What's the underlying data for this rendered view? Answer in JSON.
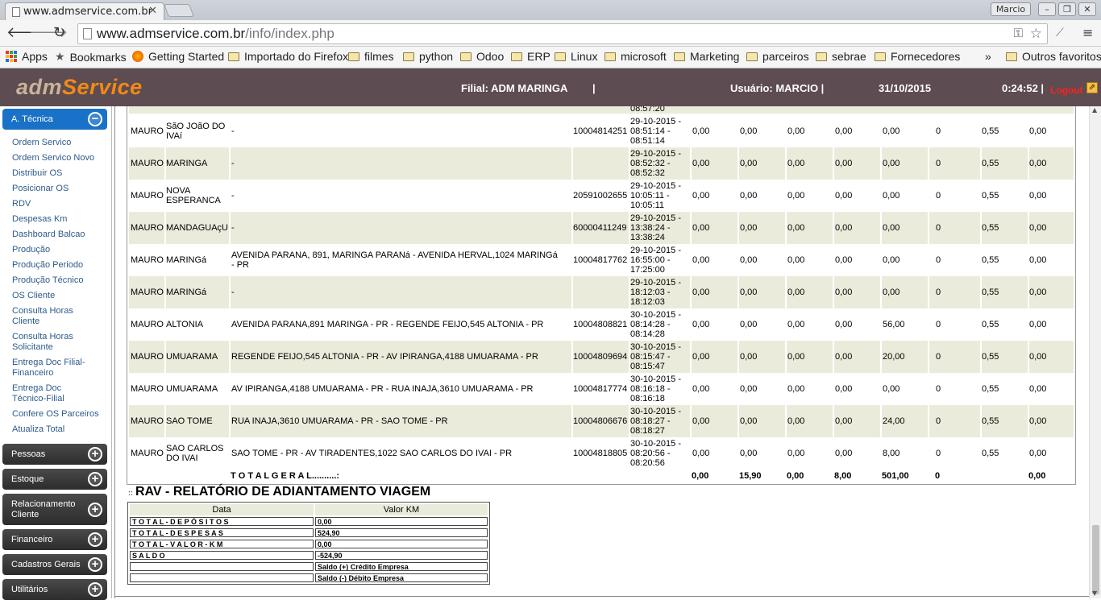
{
  "browser": {
    "tab_title": "www.admservice.com.br",
    "profile_name": "Marcio",
    "url_host": "www.admservice.com.br",
    "url_path": "/info/index.php",
    "bookmarks": [
      "Apps",
      "Bookmarks",
      "Getting Started",
      "Importado do Firefox",
      "filmes",
      "python",
      "Odoo",
      "ERP",
      "Linux",
      "microsoft",
      "Marketing",
      "parceiros",
      "sebrae",
      "Fornecedores"
    ],
    "overflow": "»",
    "other_bookmarks": "Outros favoritos"
  },
  "header": {
    "logo_adm": "adm",
    "logo_service": "Service",
    "filial": "Filial: ADM MARINGA",
    "sep": "|",
    "usuario": "Usuário: MARCIO |",
    "date": "31/10/2015",
    "time": "0:24:52 |",
    "logout": "Logout"
  },
  "sidebar": {
    "active_section": "A. Técnica",
    "items": [
      "Ordem Servico",
      "Ordem Servico Novo",
      "Distribuir OS",
      "Posicionar OS",
      "RDV",
      "Despesas Km",
      "Dashboard Balcao",
      "Produção",
      "Produção Periodo",
      "Produção Técnico",
      "OS Cliente",
      "Consulta Horas Cliente",
      "Consulta Horas Solicitante",
      "Entrega Doc Filial-Financeiro",
      "Entrega Doc Técnico-Filial",
      "Confere OS Parceiros",
      "Atualiza Total"
    ],
    "sections": [
      "Pessoas",
      "Estoque",
      "Relacionamento Cliente",
      "Financeiro",
      "Cadastros Gerais",
      "Utilitários"
    ]
  },
  "table": {
    "partial_top_time": "08:57:20",
    "rows": [
      {
        "tecnico": "MAURO",
        "cidade": "SãO JOãO DO IVAí",
        "endereco": "-",
        "os": "10004814251",
        "data": "29-10-2015 - 08:51:14 - 08:51:14",
        "v1": "0,00",
        "v2": "0,00",
        "v3": "0,00",
        "v4": "0,00",
        "v5": "0,00",
        "v6": "0",
        "v7": "0,55",
        "v8": "0,00"
      },
      {
        "tecnico": "MAURO",
        "cidade": "MARINGA",
        "endereco": "-",
        "os": "",
        "data": "29-10-2015 - 08:52:32 - 08:52:32",
        "v1": "0,00",
        "v2": "0,00",
        "v3": "0,00",
        "v4": "0,00",
        "v5": "0,00",
        "v6": "0",
        "v7": "0,55",
        "v8": "0,00"
      },
      {
        "tecnico": "MAURO",
        "cidade": "NOVA ESPERANCA",
        "endereco": "-",
        "os": "20591002655",
        "data": "29-10-2015 - 10:05:11 - 10:05:11",
        "v1": "0,00",
        "v2": "0,00",
        "v3": "0,00",
        "v4": "0,00",
        "v5": "0,00",
        "v6": "0",
        "v7": "0,55",
        "v8": "0,00"
      },
      {
        "tecnico": "MAURO",
        "cidade": "MANDAGUAçU",
        "endereco": "-",
        "os": "60000411249",
        "data": "29-10-2015 - 13:38:24 - 13:38:24",
        "v1": "0,00",
        "v2": "0,00",
        "v3": "0,00",
        "v4": "0,00",
        "v5": "0,00",
        "v6": "0",
        "v7": "0,55",
        "v8": "0,00"
      },
      {
        "tecnico": "MAURO",
        "cidade": "MARINGá",
        "endereco": "AVENIDA PARANA, 891, MARINGA PARANá - AVENIDA HERVAL,1024 MARINGá - PR",
        "os": "10004817762",
        "data": "29-10-2015 - 16:55:00 - 17:25:00",
        "v1": "0,00",
        "v2": "0,00",
        "v3": "0,00",
        "v4": "0,00",
        "v5": "0,00",
        "v6": "0",
        "v7": "0,55",
        "v8": "0,00"
      },
      {
        "tecnico": "MAURO",
        "cidade": "MARINGá",
        "endereco": "-",
        "os": "",
        "data": "29-10-2015 - 18:12:03 - 18:12:03",
        "v1": "0,00",
        "v2": "0,00",
        "v3": "0,00",
        "v4": "0,00",
        "v5": "0,00",
        "v6": "0",
        "v7": "0,55",
        "v8": "0,00"
      },
      {
        "tecnico": "MAURO",
        "cidade": "ALTONIA",
        "endereco": "AVENIDA PARANA,891 MARINGA - PR - REGENDE FEIJO,545 ALTONIA - PR",
        "os": "10004808821",
        "data": "30-10-2015 - 08:14:28 - 08:14:28",
        "v1": "0,00",
        "v2": "0,00",
        "v3": "0,00",
        "v4": "0,00",
        "v5": "56,00",
        "v6": "0",
        "v7": "0,55",
        "v8": "0,00"
      },
      {
        "tecnico": "MAURO",
        "cidade": "UMUARAMA",
        "endereco": "REGENDE FEIJO,545 ALTONIA - PR - AV IPIRANGA,4188 UMUARAMA - PR",
        "os": "10004809694",
        "data": "30-10-2015 - 08:15:47 - 08:15:47",
        "v1": "0,00",
        "v2": "0,00",
        "v3": "0,00",
        "v4": "0,00",
        "v5": "20,00",
        "v6": "0",
        "v7": "0,55",
        "v8": "0,00"
      },
      {
        "tecnico": "MAURO",
        "cidade": "UMUARAMA",
        "endereco": "AV IPIRANGA,4188 UMUARAMA - PR - RUA INAJA,3610 UMUARAMA - PR",
        "os": "10004817774",
        "data": "30-10-2015 - 08:16:18 - 08:16:18",
        "v1": "0,00",
        "v2": "0,00",
        "v3": "0,00",
        "v4": "0,00",
        "v5": "0,00",
        "v6": "0",
        "v7": "0,55",
        "v8": "0,00"
      },
      {
        "tecnico": "MAURO",
        "cidade": "SAO TOME",
        "endereco": "RUA INAJA,3610 UMUARAMA - PR - SAO TOME - PR",
        "os": "10004806676",
        "data": "30-10-2015 - 08:18:27 - 08:18:27",
        "v1": "0,00",
        "v2": "0,00",
        "v3": "0,00",
        "v4": "0,00",
        "v5": "24,00",
        "v6": "0",
        "v7": "0,55",
        "v8": "0,00"
      },
      {
        "tecnico": "MAURO",
        "cidade": "SAO CARLOS DO IVAI",
        "endereco": "SAO TOME - PR - AV TIRADENTES,1022 SAO CARLOS DO IVAI - PR",
        "os": "10004818805",
        "data": "30-10-2015 - 08:20:56 - 08:20:56",
        "v1": "0,00",
        "v2": "0,00",
        "v3": "0,00",
        "v4": "0,00",
        "v5": "8,00",
        "v6": "0",
        "v7": "0,55",
        "v8": "0,00"
      }
    ],
    "totals": {
      "label": "T O T A L G E R A L..........:",
      "v1": "0,00",
      "v2": "15,90",
      "v3": "0,00",
      "v4": "8,00",
      "v5": "501,00",
      "v6": "0",
      "v8": "0,00"
    }
  },
  "rav": {
    "dots": "::",
    "title": "RAV - RELATÓRIO DE ADIANTAMENTO VIAGEM",
    "col_data": "Data",
    "col_valor": "Valor KM",
    "rows": [
      {
        "label": "T O T A L - D E P Ó S I T O S",
        "value": "0,00"
      },
      {
        "label": "T O T A L - D E S P E S A S",
        "value": "524,90"
      },
      {
        "label": "T O T A L - V A L O R - K M",
        "value": "0,00"
      },
      {
        "label": "S A L D O",
        "value": "-524,90"
      },
      {
        "label": "",
        "value": "Saldo (+) Crédito Empresa"
      },
      {
        "label": "",
        "value": "Saldo (-) Débito Empresa"
      }
    ]
  },
  "colors": {
    "header_bg": "#5d4c51",
    "active_blue": "#1a72c8",
    "alt_row": "#ebebdb",
    "logo_orange": "#f08a18",
    "logout_red": "#ff2020"
  }
}
